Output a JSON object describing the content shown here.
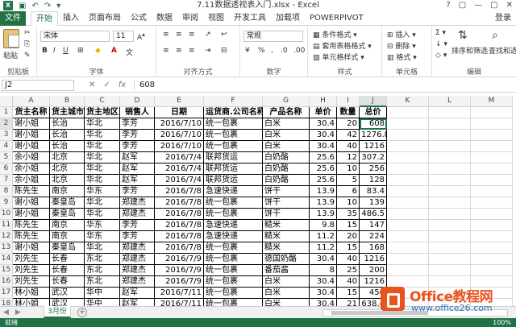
{
  "window": {
    "title": "7.11数据透视表入门.xlsx - Excel",
    "controls": [
      "?",
      "▢",
      "—",
      "▢",
      "✕"
    ]
  },
  "tabs": {
    "file": "文件",
    "items": [
      "开始",
      "插入",
      "页面布局",
      "公式",
      "数据",
      "审阅",
      "视图",
      "开发工具",
      "加载项",
      "POWERPIVOT"
    ],
    "login": "登录"
  },
  "ribbon": {
    "paste": "粘贴",
    "clipboard": "剪贴板",
    "font_name": "宋体",
    "font_size": "11",
    "font_group": "字体",
    "align_group": "对齐方式",
    "number_format": "常规",
    "number_group": "数字",
    "cond_format": "条件格式",
    "table_format": "套用表格格式",
    "cell_style": "单元格样式",
    "styles_group": "样式",
    "insert": "插入",
    "delete": "删除",
    "format": "格式",
    "cells_group": "单元格",
    "sort_filter": "排序和筛选",
    "find_select": "查找和选择",
    "edit_group": "编辑"
  },
  "formula_bar": {
    "name_box": "J2",
    "fx": "fx",
    "value": "608"
  },
  "columns": [
    "A",
    "B",
    "C",
    "D",
    "E",
    "F",
    "G",
    "H",
    "I",
    "J",
    "K",
    "L",
    "M"
  ],
  "selected_column": "J",
  "selected_row": "2",
  "headers": [
    "货主名称",
    "货主城市",
    "货主地区",
    "销售人",
    "日期",
    "运货商.公司名称",
    "产品名称",
    "单价",
    "数量",
    "总价"
  ],
  "rows": [
    [
      "谢小姐",
      "长治",
      "华北",
      "李芳",
      "2016/7/10",
      "统一包裹",
      "白米",
      "30.4",
      "20",
      "608"
    ],
    [
      "谢小姐",
      "长治",
      "华北",
      "李芳",
      "2016/7/10",
      "统一包裹",
      "白米",
      "30.4",
      "42",
      "1276.8"
    ],
    [
      "谢小姐",
      "长治",
      "华北",
      "李芳",
      "2016/7/10",
      "统一包裹",
      "白米",
      "30.4",
      "40",
      "1216"
    ],
    [
      "余小姐",
      "北京",
      "华北",
      "赵军",
      "2016/7/4",
      "联邦货运",
      "白奶酪",
      "25.6",
      "12",
      "307.2"
    ],
    [
      "余小姐",
      "北京",
      "华北",
      "赵军",
      "2016/7/4",
      "联邦货运",
      "白奶酪",
      "25.6",
      "10",
      "256"
    ],
    [
      "余小姐",
      "北京",
      "华北",
      "赵军",
      "2016/7/4",
      "联邦货运",
      "白奶酪",
      "25.6",
      "5",
      "128"
    ],
    [
      "陈先生",
      "南京",
      "华东",
      "李芳",
      "2016/7/8",
      "急速快递",
      "饼干",
      "13.9",
      "6",
      "83.4"
    ],
    [
      "谢小姐",
      "秦皇岛",
      "华北",
      "郑建杰",
      "2016/7/8",
      "统一包裹",
      "饼干",
      "13.9",
      "10",
      "139"
    ],
    [
      "谢小姐",
      "秦皇岛",
      "华北",
      "郑建杰",
      "2016/7/8",
      "统一包裹",
      "饼干",
      "13.9",
      "35",
      "486.5"
    ],
    [
      "陈先生",
      "南京",
      "华东",
      "李芳",
      "2016/7/8",
      "急速快递",
      "糙米",
      "9.8",
      "15",
      "147"
    ],
    [
      "陈先生",
      "南京",
      "华东",
      "李芳",
      "2016/7/8",
      "急速快递",
      "糙米",
      "11.2",
      "20",
      "224"
    ],
    [
      "谢小姐",
      "秦皇岛",
      "华北",
      "郑建杰",
      "2016/7/8",
      "统一包裹",
      "糙米",
      "11.2",
      "15",
      "168"
    ],
    [
      "刘先生",
      "长春",
      "东北",
      "郑建杰",
      "2016/7/9",
      "统一包裹",
      "德国奶酪",
      "30.4",
      "40",
      "1216"
    ],
    [
      "刘先生",
      "长春",
      "东北",
      "郑建杰",
      "2016/7/9",
      "统一包裹",
      "番茄酱",
      "8",
      "25",
      "200"
    ],
    [
      "刘先生",
      "长春",
      "东北",
      "郑建杰",
      "2016/7/9",
      "统一包裹",
      "白米",
      "30.4",
      "40",
      "1216"
    ],
    [
      "林小姐",
      "武汉",
      "华中",
      "赵军",
      "2016/7/11",
      "统一包裹",
      "白米",
      "30.4",
      "15",
      "456"
    ],
    [
      "林小姐",
      "武汉",
      "华中",
      "赵军",
      "2016/7/11",
      "统一包裹",
      "白米",
      "30.4",
      "21",
      "638.4"
    ],
    [
      "林小姐",
      "武汉",
      "华中",
      "赵军",
      "2016/7/11",
      "统一包裹",
      "白米",
      "30.4",
      "21",
      "638.4"
    ]
  ],
  "row_numbers": [
    "1",
    "2",
    "3",
    "4",
    "5",
    "6",
    "7",
    "8",
    "9",
    "10",
    "11",
    "12",
    "13",
    "14",
    "15",
    "16",
    "17",
    "18",
    "19"
  ],
  "sheet": {
    "name": "3月份",
    "add": "+"
  },
  "status": {
    "ready": "就绪",
    "zoom": "100%"
  },
  "watermark": {
    "name": "Office教程网",
    "url": "www.office26.com"
  },
  "colors": {
    "accent": "#217346",
    "watermark_orange": "#e8541e",
    "watermark_blue": "#2f77c6"
  }
}
